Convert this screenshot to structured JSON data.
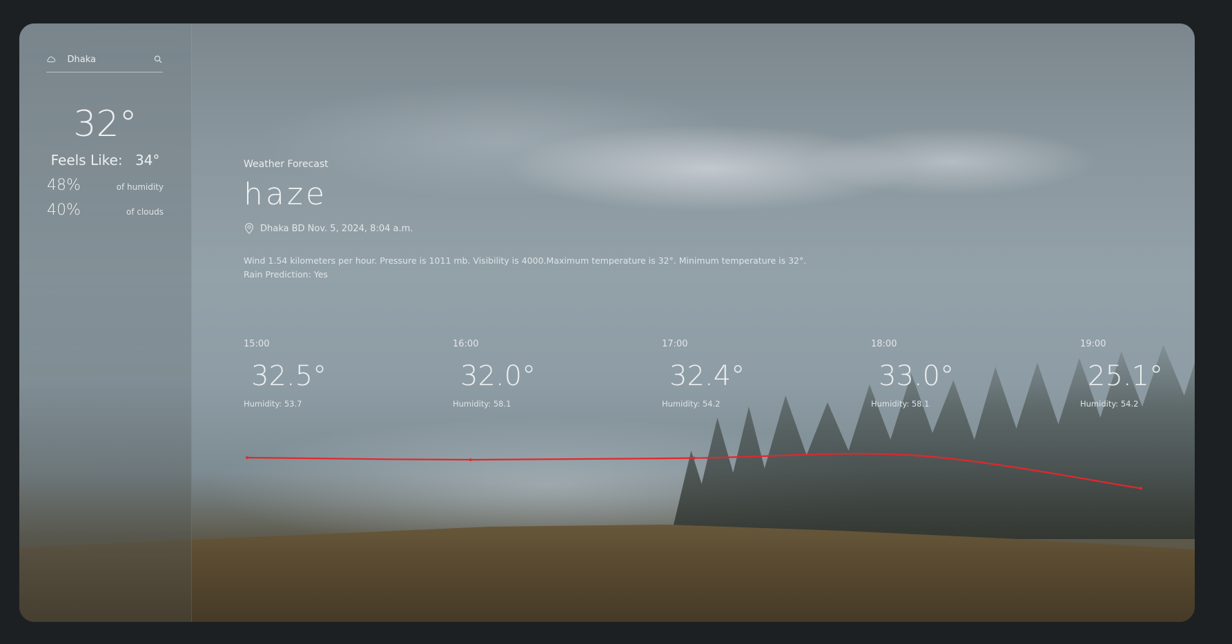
{
  "search": {
    "value": "Dhaka"
  },
  "current": {
    "temperature": "32°",
    "feels_like_label": "Feels Like:",
    "feels_like_value": "34°",
    "humidity_value": "48%",
    "humidity_label": "of humidity",
    "clouds_value": "40%",
    "clouds_label": "of clouds"
  },
  "forecast": {
    "subtitle": "Weather Forecast",
    "condition": "haze",
    "location_line": "Dhaka BD Nov. 5, 2024, 8:04 a.m.",
    "description": "Wind 1.54 kilometers per hour. Pressure is 1011 mb. Visibility is 4000.Maximum temperature is 32°. Minimum temperature is 32°.",
    "rain_prediction": "Rain Prediction: Yes"
  },
  "hourly": [
    {
      "time": "15:00",
      "temp": "32.5°",
      "humidity": "Humidity: 53.7"
    },
    {
      "time": "16:00",
      "temp": "32.0°",
      "humidity": "Humidity: 58.1"
    },
    {
      "time": "17:00",
      "temp": "32.4°",
      "humidity": "Humidity: 54.2"
    },
    {
      "time": "18:00",
      "temp": "33.0°",
      "humidity": "Humidity: 58.1"
    },
    {
      "time": "19:00",
      "temp": "25.1°",
      "humidity": "Humidity: 54.2"
    }
  ],
  "chart_data": {
    "type": "line",
    "categories": [
      "15:00",
      "16:00",
      "17:00",
      "18:00",
      "19:00"
    ],
    "values": [
      32.5,
      32.0,
      32.4,
      33.0,
      25.1
    ],
    "color": "#e0282c"
  },
  "colors": {
    "line": "#e0282c",
    "text": "#eef0f1"
  },
  "icons": {
    "search_left": "cloud-icon",
    "search_right": "search-icon",
    "location": "location-pin-icon"
  }
}
